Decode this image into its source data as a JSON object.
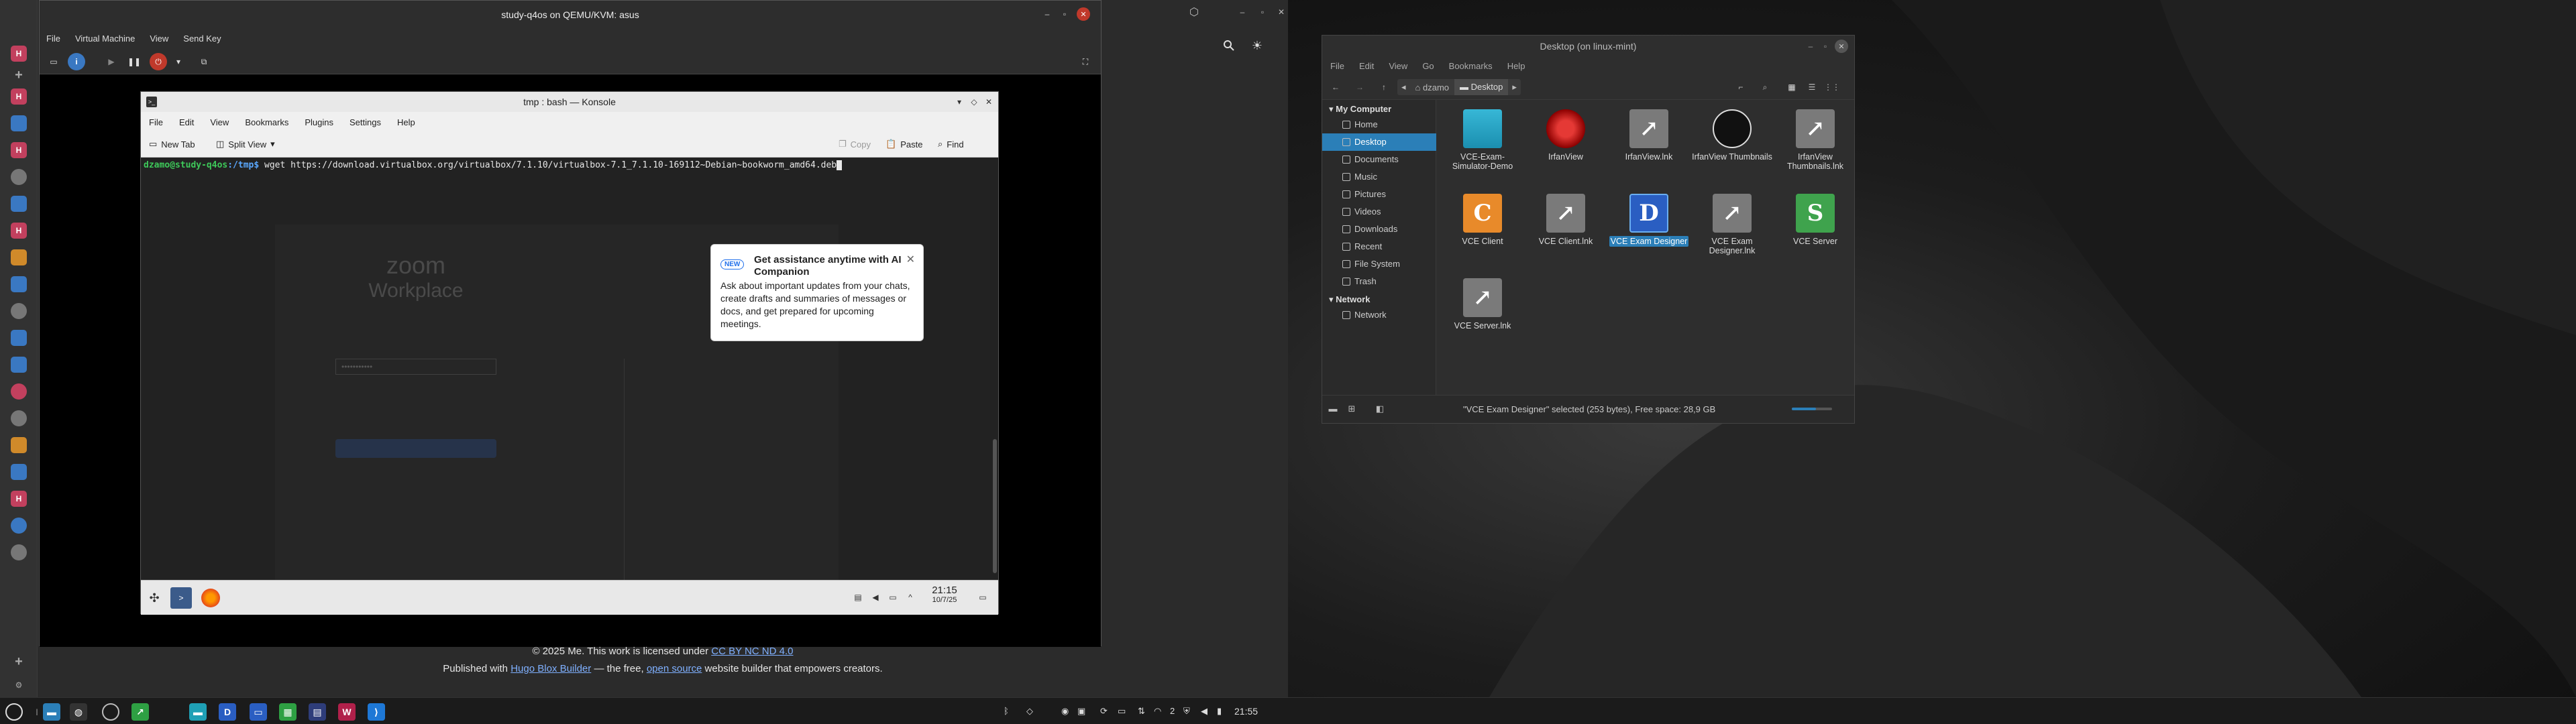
{
  "vm": {
    "title": "study-q4os on QEMU/KVM: asus",
    "menu": [
      "File",
      "Virtual Machine",
      "View",
      "Send Key"
    ]
  },
  "konsole": {
    "title": "tmp : bash — Konsole",
    "menu": [
      "File",
      "Edit",
      "View",
      "Bookmarks",
      "Plugins",
      "Settings",
      "Help"
    ],
    "toolbar": {
      "new_tab": "New Tab",
      "split_view": "Split View",
      "copy": "Copy",
      "paste": "Paste",
      "find": "Find"
    },
    "prompt_user": "dzamo@study-q4os",
    "prompt_path": ":/tmp$",
    "command": " wget https://download.virtualbox.org/virtualbox/7.1.10/virtualbox-7.1_7.1.10-169112~Debian~bookworm_amd64.deb",
    "clock_time": "21:15",
    "clock_date": "10/7/25"
  },
  "zoom_ghost": {
    "logo_line1": "zoom",
    "logo_line2": "Workplace",
    "password_dots": "•••••••••••"
  },
  "popup": {
    "badge": "NEW",
    "title": "Get assistance anytime with AI Companion",
    "body": "Ask about important updates from your chats, create drafts and summaries of messages or docs, and get prepared for upcoming meetings."
  },
  "browser_footer": {
    "line1_prefix": "© 2025 Me. This work is licensed under ",
    "license_link": "CC BY NC ND 4.0",
    "line2_prefix": "Published with ",
    "builder_link": "Hugo Blox Builder",
    "line2_mid": " — the free, ",
    "opensource_link": "open source",
    "line2_suffix": " website builder that empowers creators."
  },
  "file_manager": {
    "title": "Desktop (on linux-mint)",
    "menu": [
      "File",
      "Edit",
      "View",
      "Go",
      "Bookmarks",
      "Help"
    ],
    "breadcrumb": [
      "dzamo",
      "Desktop"
    ],
    "sidebar_heading_computer": "My Computer",
    "sidebar_items": [
      "Home",
      "Desktop",
      "Documents",
      "Music",
      "Pictures",
      "Videos",
      "Downloads",
      "Recent",
      "File System",
      "Trash"
    ],
    "sidebar_heading_network": "Network",
    "network_items": [
      "Network"
    ],
    "files": [
      {
        "name": "VCE-Exam-Simulator-Demo",
        "icon": "folder-icon"
      },
      {
        "name": "IrfanView",
        "icon": "irfanview-icon"
      },
      {
        "name": "IrfanView.lnk",
        "icon": "link-icon"
      },
      {
        "name": "IrfanView Thumbnails",
        "icon": "panda-icon"
      },
      {
        "name": "IrfanView Thumbnails.lnk",
        "icon": "link-icon"
      },
      {
        "name": "VCE Client",
        "icon": "vce-client-icon",
        "glyph": "C"
      },
      {
        "name": "VCE Client.lnk",
        "icon": "link-icon"
      },
      {
        "name": "VCE Exam Designer",
        "icon": "vce-designer-icon",
        "glyph": "D"
      },
      {
        "name": "VCE Exam Designer.lnk",
        "icon": "link-icon"
      },
      {
        "name": "VCE Server",
        "icon": "vce-server-icon",
        "glyph": "S"
      },
      {
        "name": "VCE Server.lnk",
        "icon": "link-icon"
      }
    ],
    "status": "\"VCE Exam Designer\" selected (253 bytes), Free space: 28,9 GB"
  },
  "taskbar": {
    "clock": "21:55",
    "workspace": "2"
  },
  "colors": {
    "selection": "#2b7fb8",
    "prompt_user": "#3ec95a",
    "prompt_path": "#5aa8ff"
  }
}
